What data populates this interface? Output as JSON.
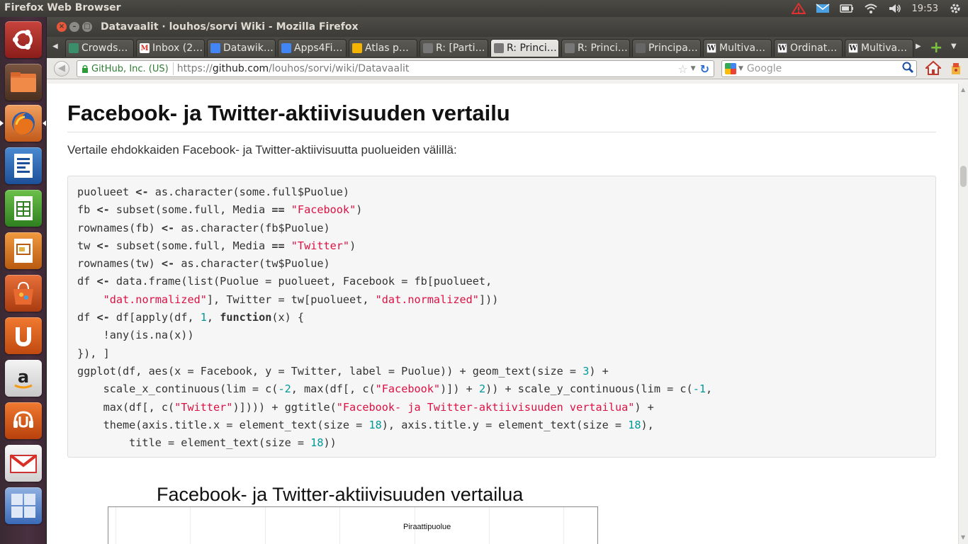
{
  "panel": {
    "app_name": "Firefox Web Browser",
    "clock": "19:53"
  },
  "window": {
    "title": "Datavaalit · louhos/sorvi Wiki - Mozilla Firefox"
  },
  "tabs": [
    {
      "label": "Crowds…",
      "icon": "crowdsourcing-icon",
      "color": "#3a8f6a"
    },
    {
      "label": "Inbox (2…",
      "icon": "gmail-icon",
      "color": "#d93025"
    },
    {
      "label": "Datawik…",
      "icon": "docs-icon",
      "color": "#4285f4"
    },
    {
      "label": "Apps4Fi…",
      "icon": "docs-icon",
      "color": "#4285f4"
    },
    {
      "label": "Atlas p…",
      "icon": "slides-icon",
      "color": "#f4b400"
    },
    {
      "label": "R: [Parti…",
      "icon": "page-icon",
      "color": "#777777"
    },
    {
      "label": "R: Princi…",
      "icon": "page-icon",
      "color": "#777777",
      "active": true
    },
    {
      "label": "R: Princi…",
      "icon": "page-icon",
      "color": "#777777"
    },
    {
      "label": "Principa…",
      "icon": "book-icon",
      "color": "#666666"
    },
    {
      "label": "Multiva…",
      "icon": "wikipedia-icon",
      "color": "#222222"
    },
    {
      "label": "Ordinat…",
      "icon": "wikipedia-icon",
      "color": "#222222"
    },
    {
      "label": "Multiva…",
      "icon": "wikipedia-icon",
      "color": "#222222"
    }
  ],
  "navbar": {
    "identity": "GitHub, Inc. (US)",
    "url_scheme": "https://",
    "url_host": "github.com",
    "url_path": "/louhos/sorvi/wiki/Datavaalit",
    "search_placeholder": "Google"
  },
  "page": {
    "heading": "Facebook- ja Twitter-aktiivisuuden vertailu",
    "intro": "Vertaile ehdokkaiden Facebook- ja Twitter-aktiivisuutta puolueiden välillä:",
    "plot_title": "Facebook- ja Twitter-aktiivisuuden vertailua",
    "plot_label": "Piraattipuolue"
  },
  "code": {
    "l1a": "puolueet ",
    "l1b": "<-",
    "l1c": " as.character(some.full$Puolue)",
    "l2a": "fb ",
    "l2b": "<-",
    "l2c": " subset(some.full, Media ",
    "l2d": "==",
    "l2e": " ",
    "l2s": "\"Facebook\"",
    "l2f": ")",
    "l3a": "rownames(fb) ",
    "l3b": "<-",
    "l3c": " as.character(fb$Puolue)",
    "l4a": "tw ",
    "l4b": "<-",
    "l4c": " subset(some.full, Media ",
    "l4d": "==",
    "l4e": " ",
    "l4s": "\"Twitter\"",
    "l4f": ")",
    "l5a": "rownames(tw) ",
    "l5b": "<-",
    "l5c": " as.character(tw$Puolue)",
    "l6a": "df ",
    "l6b": "<-",
    "l6c": " data.frame(list(Puolue = puolueet, Facebook = fb[puolueet,",
    "l7a": "    ",
    "l7s": "\"dat.normalized\"",
    "l7b": "], Twitter = tw[puolueet, ",
    "l7s2": "\"dat.normalized\"",
    "l7c": "]))",
    "l8a": "df ",
    "l8b": "<-",
    "l8c": " df[apply(df, ",
    "l8n": "1",
    "l8d": ", ",
    "l8k": "function",
    "l8e": "(x) {",
    "l9": "    !any(is.na(x))",
    "l10": "}), ]",
    "l11a": "ggplot(df, aes(x = Facebook, y = Twitter, label = Puolue)) + geom_text(size = ",
    "l11n": "3",
    "l11b": ") +",
    "l12a": "    scale_x_continuous(lim = c(",
    "l12n1": "-2",
    "l12b": ", max(df[, c(",
    "l12s": "\"Facebook\"",
    "l12c": ")]) + ",
    "l12n2": "2",
    "l12d": ")) + scale_y_continuous(lim = c(",
    "l12n3": "-1",
    "l12e": ",",
    "l13a": "    max(df[, c(",
    "l13s": "\"Twitter\"",
    "l13b": ")]))) + ggtitle(",
    "l13s2": "\"Facebook- ja Twitter-aktiivisuuden vertailua\"",
    "l13c": ") +",
    "l14a": "    theme(axis.title.x = element_text(size = ",
    "l14n1": "18",
    "l14b": "), axis.title.y = element_text(size = ",
    "l14n2": "18",
    "l14c": "),",
    "l15a": "        title = element_text(size = ",
    "l15n": "18",
    "l15b": "))"
  },
  "launcher": [
    {
      "name": "ubuntu-dash-icon"
    },
    {
      "name": "files-icon"
    },
    {
      "name": "firefox-icon"
    },
    {
      "name": "writer-icon"
    },
    {
      "name": "calc-icon"
    },
    {
      "name": "impress-icon"
    },
    {
      "name": "software-center-icon"
    },
    {
      "name": "ubuntu-one-icon"
    },
    {
      "name": "amazon-icon"
    },
    {
      "name": "ubuntu-one-music-icon"
    },
    {
      "name": "gmail-icon"
    },
    {
      "name": "workspace-switcher-icon"
    }
  ],
  "colors": {
    "code_string": "#dd1144",
    "code_number": "#009999",
    "secure_green": "#2e7d32"
  }
}
